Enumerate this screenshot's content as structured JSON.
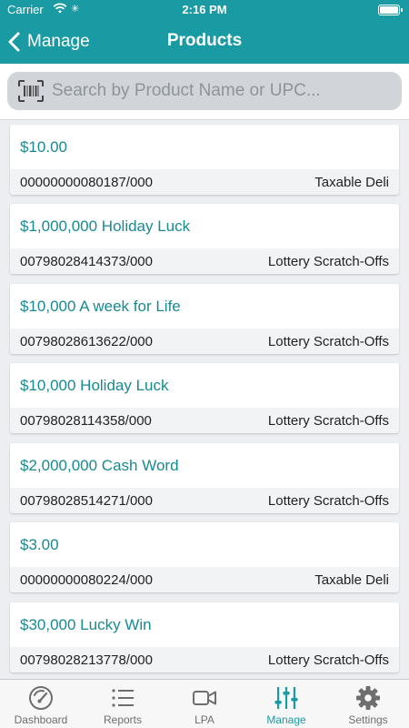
{
  "status_bar": {
    "carrier": "Carrier",
    "time": "2:16 PM"
  },
  "nav": {
    "back_label": "Manage",
    "title": "Products"
  },
  "search": {
    "placeholder": "Search by Product Name or UPC..."
  },
  "products": [
    {
      "name": "$10.00",
      "upc": "00000000080187/000",
      "category": "Taxable Deli"
    },
    {
      "name": "$1,000,000 Holiday Luck",
      "upc": "00798028414373/000",
      "category": "Lottery Scratch-Offs"
    },
    {
      "name": "$10,000 A week for Life",
      "upc": "00798028613622/000",
      "category": "Lottery Scratch-Offs"
    },
    {
      "name": "$10,000 Holiday Luck",
      "upc": "00798028114358/000",
      "category": "Lottery Scratch-Offs"
    },
    {
      "name": "$2,000,000 Cash Word",
      "upc": "00798028514271/000",
      "category": "Lottery Scratch-Offs"
    },
    {
      "name": "$3.00",
      "upc": "00000000080224/000",
      "category": "Taxable Deli"
    },
    {
      "name": "$30,000 Lucky Win",
      "upc": "00798028213778/000",
      "category": "Lottery Scratch-Offs"
    }
  ],
  "tabs": [
    {
      "label": "Dashboard",
      "icon": "dashboard-icon",
      "active": false
    },
    {
      "label": "Reports",
      "icon": "list-icon",
      "active": false
    },
    {
      "label": "LPA",
      "icon": "video-icon",
      "active": false
    },
    {
      "label": "Manage",
      "icon": "sliders-icon",
      "active": true
    },
    {
      "label": "Settings",
      "icon": "gear-icon",
      "active": false
    }
  ],
  "colors": {
    "brand": "#1a9ba3",
    "product_name": "#178a92",
    "tab_inactive": "#6e6e6e"
  }
}
